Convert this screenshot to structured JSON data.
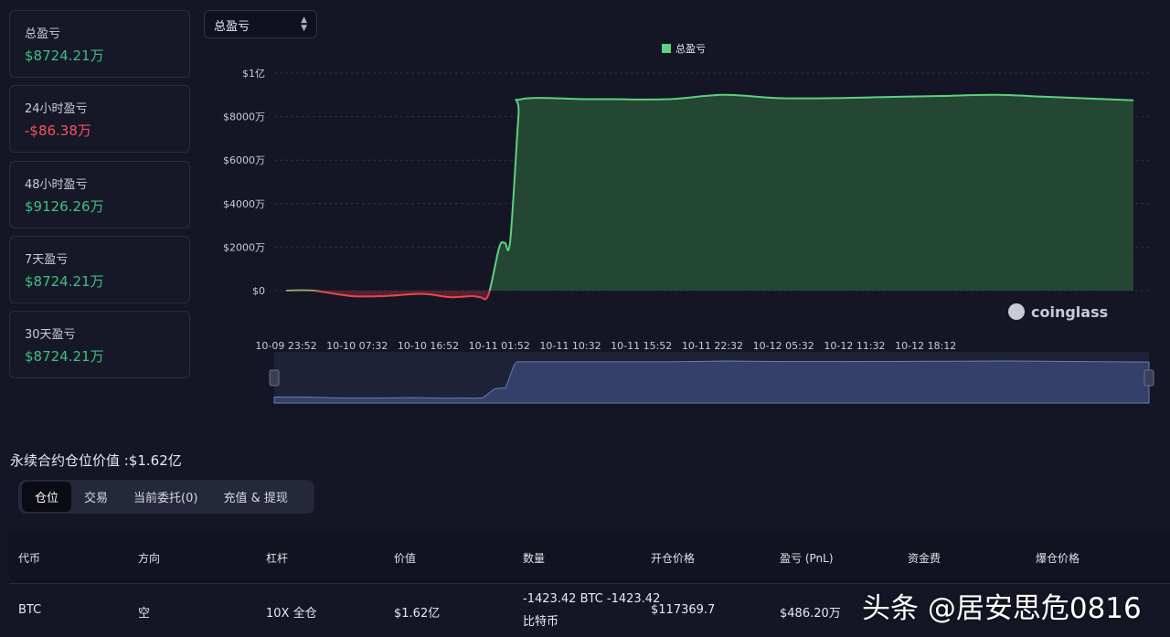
{
  "stats": [
    {
      "label": "总盈亏",
      "value": "$8724.21万",
      "positive": true
    },
    {
      "label": "24小时盈亏",
      "value": "-$86.38万",
      "positive": false
    },
    {
      "label": "48小时盈亏",
      "value": "$9126.26万",
      "positive": true
    },
    {
      "label": "7天盈亏",
      "value": "$8724.21万",
      "positive": true
    },
    {
      "label": "30天盈亏",
      "value": "$8724.21万",
      "positive": true
    }
  ],
  "metric_select": {
    "value": "总盈亏"
  },
  "chart_data": {
    "type": "area",
    "series": [
      {
        "name": "总盈亏",
        "color": "#5fd07f"
      }
    ],
    "negative_color": "#e5484d",
    "x": [
      0,
      0.05,
      0.12,
      0.18,
      0.25,
      0.3,
      0.34,
      0.355,
      0.37,
      0.39,
      0.4,
      0.41,
      0.425,
      0.43,
      0.55,
      0.6,
      0.7,
      0.8,
      0.9,
      1.0,
      1.1,
      1.2,
      1.3,
      1.4,
      1.55
    ],
    "x_ticks": [
      "10-09 23:52",
      "10-10 07:32",
      "10-10 16:52",
      "10-11 01:52",
      "10-11 10:32",
      "10-11 15:52",
      "10-11 22:32",
      "10-12 05:32",
      "10-12 11:32",
      "10-12 18:12"
    ],
    "x_tick_positions": [
      0,
      0.13,
      0.26,
      0.39,
      0.52,
      0.65,
      0.78,
      0.91,
      1.04,
      1.17
    ],
    "y_values_wan": [
      0,
      0,
      -250,
      -250,
      -150,
      -300,
      -250,
      -300,
      -200,
      2000,
      2200,
      2300,
      8000,
      8800,
      8800,
      8800,
      8800,
      9000,
      8850,
      8850,
      8900,
      8950,
      9000,
      8900,
      8750
    ],
    "y_ticks": [
      "$1亿",
      "$8000万",
      "$6000万",
      "$4000万",
      "$2000万",
      "$0"
    ],
    "ylim_wan": [
      -600,
      10000
    ],
    "brand": "coinglass"
  },
  "perp_title": "永续合约仓位价值 :$1.62亿",
  "tabs": [
    "仓位",
    "交易",
    "当前委托(0)",
    "充值 & 提现"
  ],
  "table": {
    "headers": [
      "代币",
      "方向",
      "杠杆",
      "价值",
      "数量",
      "开仓价格",
      "盈亏 (PnL)",
      "资金费",
      "爆仓价格"
    ],
    "rows": [
      {
        "token": "BTC",
        "direction": "空",
        "leverage": "10X 全仓",
        "value": "$1.62亿",
        "qty_line1": "-1423.42 BTC  -1423.42",
        "qty_line2": "比特币",
        "entry_price": "$117369.7",
        "pnl": "$486.20万"
      }
    ]
  },
  "watermark": "头条 @居安思危0816"
}
